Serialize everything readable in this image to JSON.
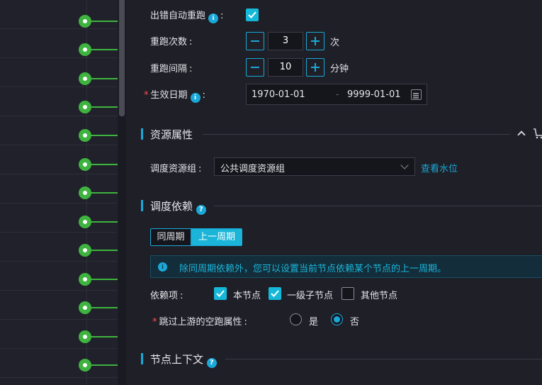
{
  "form": {
    "auto_rerun": {
      "label": "出错自动重跑",
      "colon": ":",
      "checked": true
    },
    "rerun_count": {
      "label": "重跑次数",
      "colon": ":",
      "value": "3",
      "unit": "次"
    },
    "rerun_interval": {
      "label": "重跑间隔",
      "colon": ":",
      "value": "10",
      "unit": "分钟"
    },
    "effective_date": {
      "required_mark": "*",
      "label": "生效日期",
      "colon": ":",
      "start": "1970-01-01",
      "separator": "-",
      "end": "9999-01-01"
    }
  },
  "resource": {
    "title": "资源属性",
    "group_label": "调度资源组",
    "colon": ":",
    "group_value": "公共调度资源组",
    "watermark_link": "查看水位"
  },
  "dependency": {
    "title": "调度依赖",
    "tabs": [
      {
        "label": "同周期",
        "active": false
      },
      {
        "label": "上一周期",
        "active": true
      }
    ],
    "notice": "除同周期依赖外，您可以设置当前节点依赖某个节点的上一周期。",
    "dep_label": "依赖项",
    "colon": ":",
    "options": [
      {
        "label": "本节点",
        "checked": true
      },
      {
        "label": "一级子节点",
        "checked": true
      },
      {
        "label": "其他节点",
        "checked": false
      }
    ],
    "skip_required_mark": "*",
    "skip_label": "跳过上游的空跑属性",
    "skip_colon": ":",
    "skip_options": [
      {
        "label": "是",
        "selected": false
      },
      {
        "label": "否",
        "selected": true
      }
    ]
  },
  "context": {
    "title": "节点上下文"
  },
  "icons": {
    "info": "info-icon",
    "help": "help-icon",
    "calendar": "calendar-icon",
    "chevron": "chevron-up-icon",
    "cart": "cart-icon",
    "timeline_node": "timeline-node-icon"
  },
  "colors": {
    "accent": "#1aa8d8",
    "node_green": "#3fb33f",
    "background": "#1e1f27"
  }
}
